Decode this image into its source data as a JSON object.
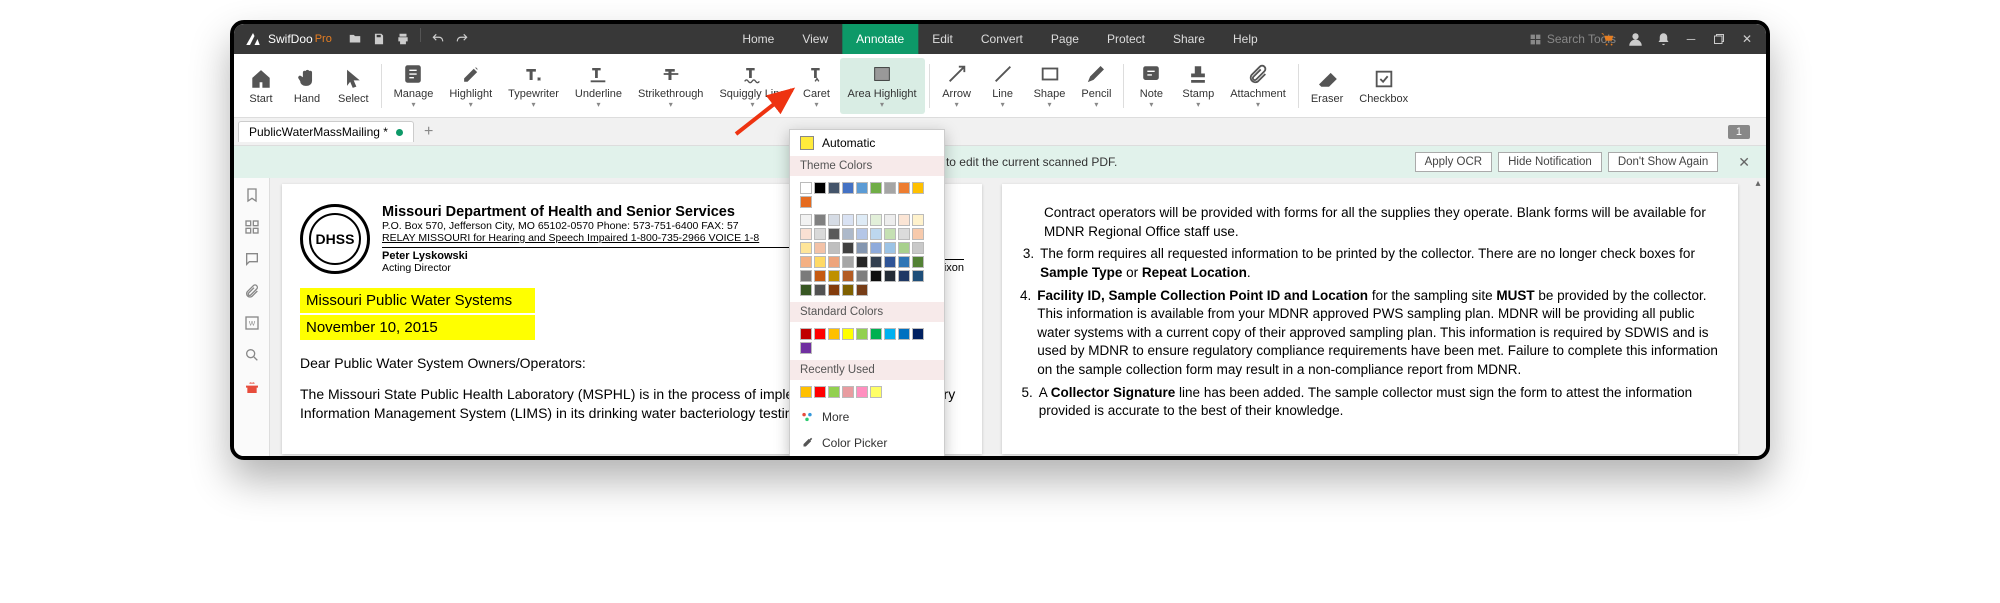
{
  "app": {
    "name": "SwifDoo",
    "edition": "Pro"
  },
  "menu": [
    "Home",
    "View",
    "Annotate",
    "Edit",
    "Convert",
    "Page",
    "Protect",
    "Share",
    "Help"
  ],
  "menu_active": 2,
  "search": {
    "placeholder": "Search Tools"
  },
  "ribbon": [
    {
      "label": "Start",
      "arrow": false
    },
    {
      "label": "Hand",
      "arrow": false
    },
    {
      "label": "Select",
      "arrow": false
    },
    {
      "label": "Manage",
      "arrow": true,
      "sep_before": true
    },
    {
      "label": "Highlight",
      "arrow": true
    },
    {
      "label": "Typewriter",
      "arrow": true
    },
    {
      "label": "Underline",
      "arrow": true
    },
    {
      "label": "Strikethrough",
      "arrow": true
    },
    {
      "label": "Squiggly Line",
      "arrow": true
    },
    {
      "label": "Caret",
      "arrow": true
    },
    {
      "label": "Area Highlight",
      "arrow": true,
      "active": true
    },
    {
      "label": "Arrow",
      "arrow": true,
      "sep_before": true
    },
    {
      "label": "Line",
      "arrow": true
    },
    {
      "label": "Shape",
      "arrow": true
    },
    {
      "label": "Pencil",
      "arrow": true
    },
    {
      "label": "Note",
      "arrow": true,
      "sep_before": true
    },
    {
      "label": "Stamp",
      "arrow": true
    },
    {
      "label": "Attachment",
      "arrow": true
    },
    {
      "label": "Eraser",
      "arrow": false,
      "sep_before": true
    },
    {
      "label": "Checkbox",
      "arrow": false
    }
  ],
  "tab": {
    "filename": "PublicWaterMassMailing *"
  },
  "page_indicator": "1",
  "ocr": {
    "msg": "Apply OCR to edit the current scanned PDF.",
    "apply": "Apply OCR",
    "hide": "Hide Notification",
    "dont": "Don't Show Again"
  },
  "popup": {
    "automatic": "Automatic",
    "section_theme": "Theme Colors",
    "section_standard": "Standard Colors",
    "section_recent": "Recently Used",
    "more": "More",
    "picker": "Color Picker",
    "theme_row1": [
      "#ffffff",
      "#000000",
      "#44546a",
      "#4472c4",
      "#5b9bd5",
      "#70ad47",
      "#a5a5a5",
      "#ed7d31",
      "#ffc000",
      "#e56b1f"
    ],
    "theme_shades": [
      [
        "#f2f2f2",
        "#808080",
        "#d6dce5",
        "#d9e2f3",
        "#deebf6",
        "#e2efd9",
        "#ededed",
        "#fbe5d5",
        "#fff2cc",
        "#f9e0d3"
      ],
      [
        "#d9d9d9",
        "#595959",
        "#adb9ca",
        "#b4c6e7",
        "#bdd7ee",
        "#c5e0b3",
        "#dbdbdb",
        "#f7caac",
        "#fee599",
        "#f3c2a7"
      ],
      [
        "#bfbfbf",
        "#404040",
        "#8496b0",
        "#8eaadb",
        "#9cc3e5",
        "#a8d08d",
        "#c9c9c9",
        "#f4b083",
        "#ffd965",
        "#eda47b"
      ],
      [
        "#a6a6a6",
        "#262626",
        "#323f4f",
        "#2f5496",
        "#2e75b5",
        "#538135",
        "#7b7b7b",
        "#c55a11",
        "#bf9000",
        "#b35c23"
      ],
      [
        "#7f7f7f",
        "#0d0d0d",
        "#222a35",
        "#1f3864",
        "#1e4e79",
        "#375623",
        "#525252",
        "#833c0c",
        "#7f6000",
        "#773d17"
      ]
    ],
    "standard": [
      "#c00000",
      "#ff0000",
      "#ffc000",
      "#ffff00",
      "#92d050",
      "#00b050",
      "#00b0f0",
      "#0070c0",
      "#002060",
      "#7030a0"
    ],
    "recent": [
      "#ffc000",
      "#ff0000",
      "#92d050",
      "#e89ca0",
      "#ff8fbf",
      "#ffff66"
    ]
  },
  "doc1": {
    "dept": "Missouri Department of Health and Senior Services",
    "addr": "P.O. Box 570, Jefferson City, MO 65102-0570    Phone: 573-751-6400    FAX: 57",
    "relay": "RELAY MISSOURI for Hearing and Speech Impaired 1-800-735-2966   VOICE 1-8",
    "name": "Peter Lyskowski",
    "title_role": "Acting Director",
    "gov": "Nixon",
    "hl1": "Missouri Public Water Systems",
    "hl2": "November 10, 2015",
    "salutation": "Dear Public Water System Owners/Operators:",
    "body": "The Missouri State Public Health Laboratory (MSPHL) is in the process of implementing a new Laboratory Information Management System (LIMS) in its drinking water bacteriology testing"
  },
  "doc2": {
    "li3pre": "Contract operators will be provided with forms for all the supplies they operate. Blank forms will be available for MDNR Regional Office staff use.",
    "li3num": "3.",
    "li3": "The form requires all requested information to be printed by the collector. There are no longer check boxes for ",
    "li3b1": "Sample Type",
    "li3mid": " or ",
    "li3b2": "Repeat Location",
    "li3end": ".",
    "li4num": "4.",
    "li4b1": "Facility ID, Sample Collection Point ID and Location",
    "li4a": " for the sampling site ",
    "li4b2": "MUST",
    "li4b": " be provided by the collector. This information is available from your MDNR approved PWS sampling plan. MDNR will be providing all public water systems with a current copy of their approved sampling plan. This information is required by SDWIS and is used by MDNR to ensure regulatory compliance requirements have been met. Failure to complete this information on the sample collection form may result in a non-compliance report from MDNR.",
    "li5num": "5.",
    "li5a": "A ",
    "li5b": "Collector Signature",
    "li5c": " line has been added. The sample collector must sign the form to attest the information provided is accurate to the best of their knowledge."
  }
}
